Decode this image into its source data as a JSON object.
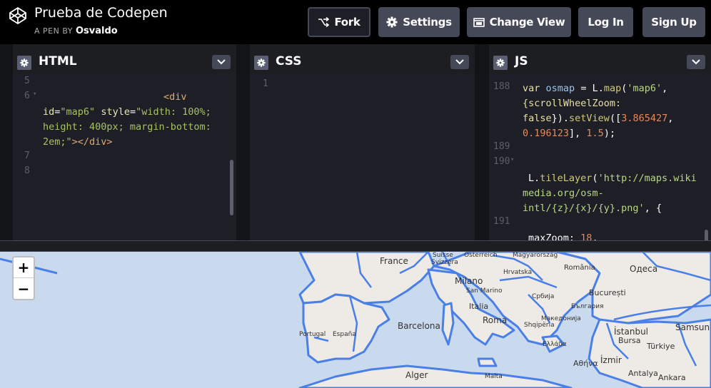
{
  "header": {
    "title": "Prueba de Codepen",
    "byline_prefix": "A PEN BY",
    "author": "Osvaldo",
    "buttons": {
      "fork": "Fork",
      "settings": "Settings",
      "change_view": "Change View",
      "login": "Log In",
      "signup": "Sign Up"
    }
  },
  "editors": {
    "html": {
      "title": "HTML",
      "line_numbers": [
        "5",
        "6",
        "7",
        "8"
      ],
      "lines": {
        "l6_tag": "<div",
        "l6b_attr1": "id",
        "l6b_eq1": "=",
        "l6b_str1": "\"map6\"",
        "l6b_attr2": "style",
        "l6b_eq2": "=",
        "l6b_str2a": "\"width: 100%;",
        "l6c": "height: 400px; margin-bottom:",
        "l6d_str": "2em;\"",
        "l6d_tag": "></div>"
      }
    },
    "css": {
      "title": "CSS",
      "line_numbers": [
        "1"
      ]
    },
    "js": {
      "title": "JS",
      "line_numbers": [
        "188",
        "189",
        "190",
        "191"
      ],
      "lines": {
        "a1_kw": "var",
        "a1_var": "osmap",
        "a1_eq": "= ",
        "a1_L": "L",
        "a1_dot": ".",
        "a1_fn": "map",
        "a1_paren": "(",
        "a1_str": "'map6'",
        "a1_comma": ",",
        "a2": "{scrollWheelZoom:",
        "a3_false": "false",
        "a3_rest": "}).",
        "a3_fn": "setView",
        "a3_open": "([",
        "a3_num": "3.865427",
        "a3_comma": ",",
        "a4_num1": "0.196123",
        "a4_mid": "], ",
        "a4_num2": "1.5",
        "a4_end": ");",
        "b1_L": "L",
        "b1_dot": ".",
        "b1_fn": "tileLayer",
        "b1_paren": "(",
        "b1_str": "'http://maps.wiki",
        "b2_str": "media.org/osm-",
        "b3_str": "intl/{z}/{x}/{y}.png'",
        "b3_end": ", {",
        "c1_key": "maxZoom",
        "c1_colon": ": ",
        "c1_num": "18",
        "c1_end": ","
      }
    }
  },
  "map": {
    "zoom_in": "+",
    "zoom_out": "−",
    "labels": {
      "france": "France",
      "suisse": "Suisse",
      "svizzera": "Svizzera",
      "osterreich": "Österreich",
      "magyarorszag": "Magyarország",
      "romania": "România",
      "odesa": "Одеса",
      "hrvatska": "Hrvatska",
      "milano": "Milano",
      "san_marino": "San Marino",
      "bucuresti": "București",
      "srbija": "Србија",
      "bulgaria": "България",
      "italia": "Italia",
      "roma": "Roma",
      "makedonija": "Македонија",
      "shqiperia": "Shqipëria",
      "barcelona": "Barcelona",
      "portugal": "Portugal",
      "espana": "España",
      "ellada": "Ελλάδα",
      "istanbul": "İstanbul",
      "bursa": "Bursa",
      "samsun": "Samsun",
      "turkiye": "Türkiye",
      "izmir": "İzmir",
      "antalya": "Antalya",
      "athina": "Αθήνα",
      "alger": "Alger",
      "malta": "Malta",
      "ankara": "Ankara"
    }
  }
}
